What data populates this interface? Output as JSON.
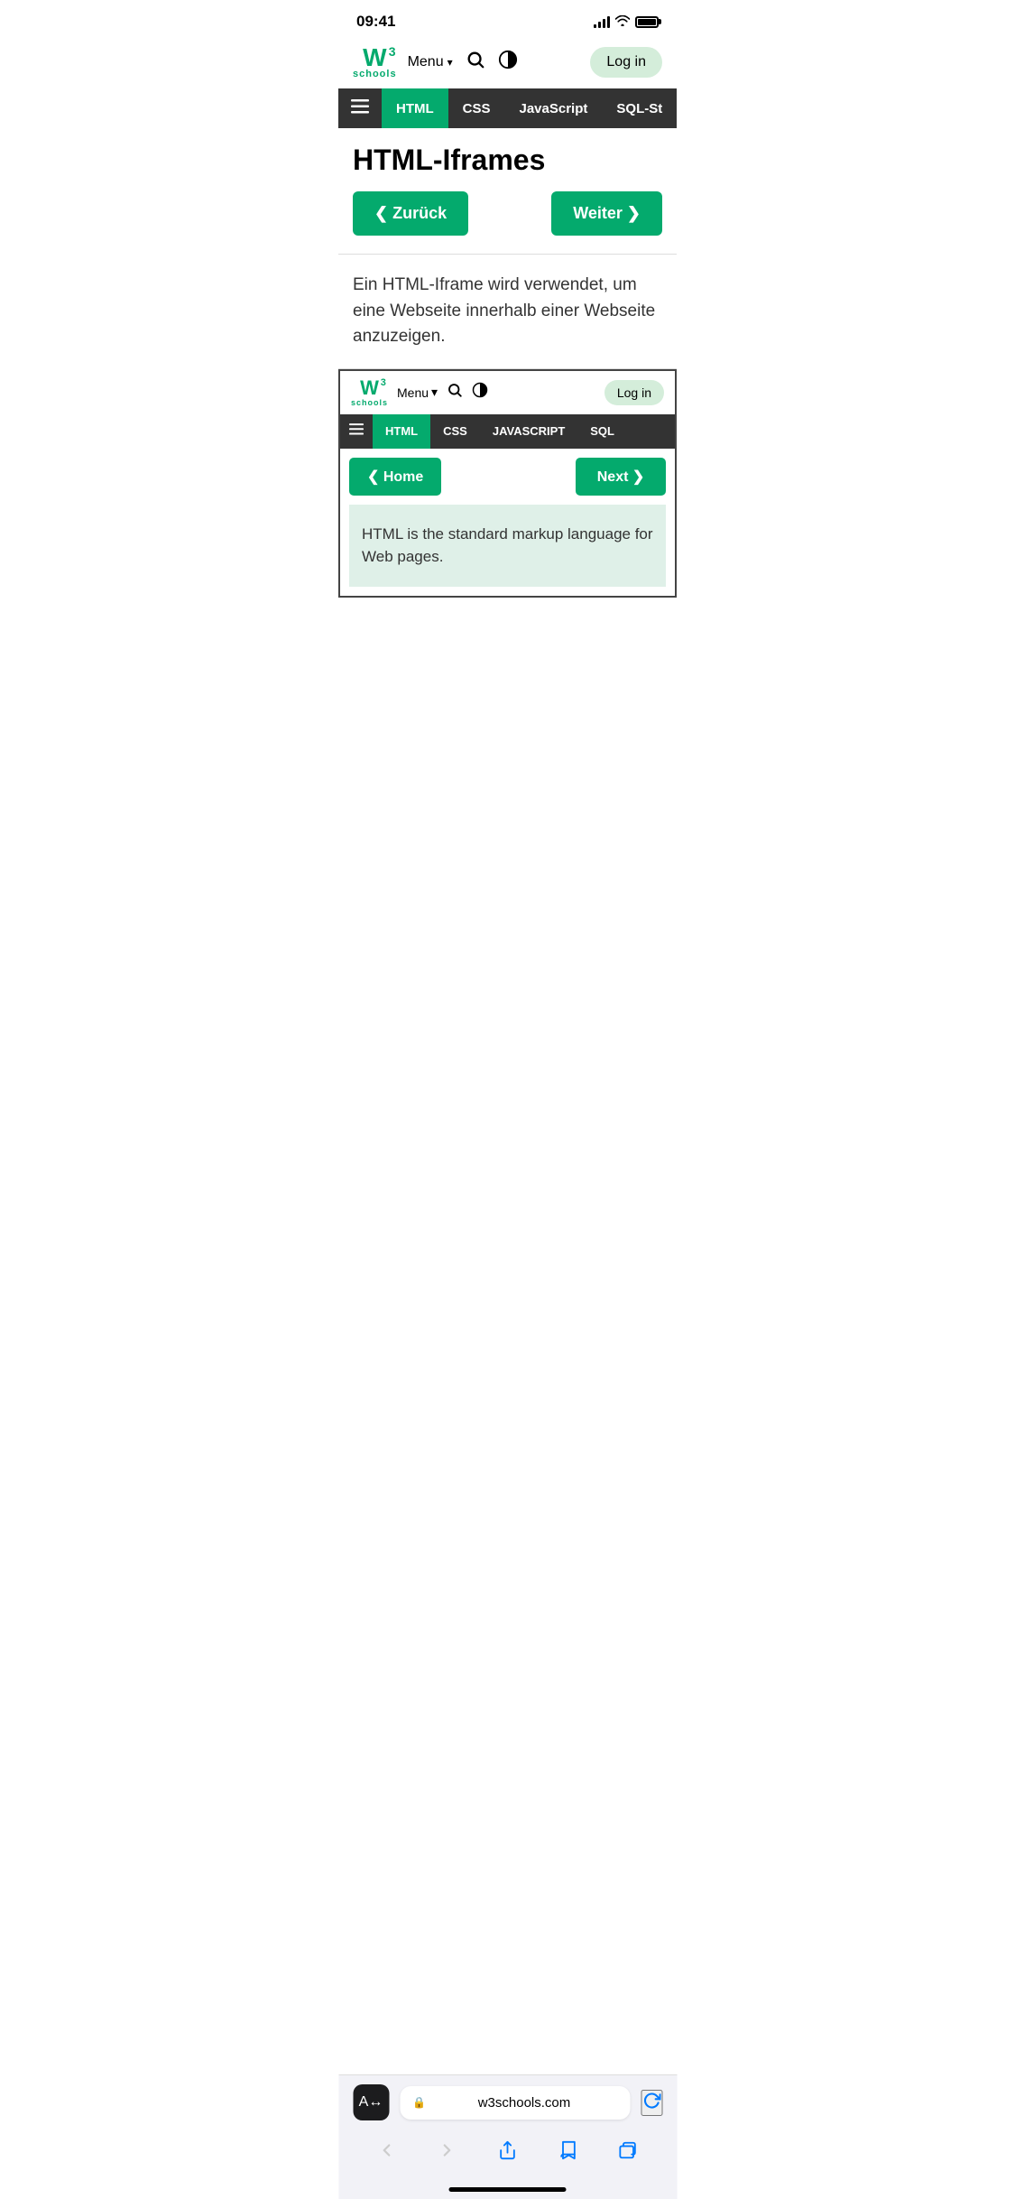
{
  "status": {
    "time": "09:41",
    "url": "w3schools.com"
  },
  "header": {
    "logo_w": "W",
    "logo_superscript": "3",
    "logo_schools": "schools",
    "menu_label": "Menu",
    "login_label": "Log in"
  },
  "nav": {
    "tabs": [
      "HTML",
      "CSS",
      "JavaScript",
      "SQL-St"
    ],
    "active_tab": "HTML"
  },
  "page": {
    "title": "HTML-Iframes",
    "back_btn": "❮ Zurück",
    "next_btn": "Weiter ❯",
    "description": "Ein HTML-Iframe wird verwendet, um eine Webseite innerhalb einer Webseite anzuzeigen."
  },
  "iframe": {
    "logo_w": "W",
    "logo_superscript": "3",
    "logo_schools": "schools",
    "menu_label": "Menu",
    "login_label": "Log in",
    "tabs": [
      "HTML",
      "CSS",
      "JAVASCRIPT",
      "SQL"
    ],
    "active_tab": "HTML",
    "back_btn": "❮ Home",
    "next_btn": "Next ❯",
    "content_text": "HTML is the standard markup language for Web pages."
  },
  "browser": {
    "address": "w3schools.com",
    "back_icon": "‹",
    "forward_icon": "›",
    "share_icon": "↑",
    "bookmarks_icon": "⊡",
    "tabs_icon": "⧉"
  }
}
